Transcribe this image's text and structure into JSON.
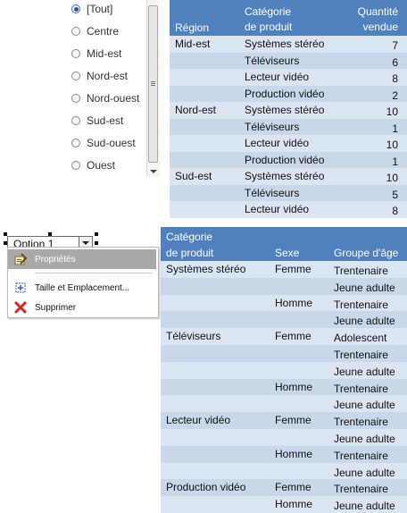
{
  "filter": {
    "options": [
      {
        "label": "[Tout]",
        "checked": true
      },
      {
        "label": "Centre",
        "checked": false
      },
      {
        "label": "Mid-est",
        "checked": false
      },
      {
        "label": "Nord-est",
        "checked": false
      },
      {
        "label": "Nord-ouest",
        "checked": false
      },
      {
        "label": "Sud-est",
        "checked": false
      },
      {
        "label": "Sud-ouest",
        "checked": false
      },
      {
        "label": "Ouest",
        "checked": false
      }
    ]
  },
  "colors": {
    "header": "#4e81bd",
    "band_dark": "#c8d7e9",
    "band_light": "#dbe5f1"
  },
  "table1": {
    "headers": {
      "region": "Région",
      "category": [
        "Catégorie",
        "de produit"
      ],
      "quantity": [
        "Quantité",
        "vendue"
      ]
    },
    "rows": [
      {
        "region": "Mid-est",
        "category": "Systèmes stéréo",
        "quantity": "7"
      },
      {
        "region": "",
        "category": "Téléviseurs",
        "quantity": "6"
      },
      {
        "region": "",
        "category": "Lecteur vidéo",
        "quantity": "8"
      },
      {
        "region": "",
        "category": "Production vidéo",
        "quantity": "2"
      },
      {
        "region": "Nord-est",
        "category": "Systèmes stéréo",
        "quantity": "10"
      },
      {
        "region": "",
        "category": "Téléviseurs",
        "quantity": "1"
      },
      {
        "region": "",
        "category": "Lecteur vidéo",
        "quantity": "10"
      },
      {
        "region": "",
        "category": "Production vidéo",
        "quantity": "1"
      },
      {
        "region": "Sud-est",
        "category": "Systèmes stéréo",
        "quantity": "10"
      },
      {
        "region": "",
        "category": "Téléviseurs",
        "quantity": "5"
      },
      {
        "region": "",
        "category": "Lecteur vidéo",
        "quantity": "8"
      }
    ]
  },
  "table2": {
    "headers": {
      "category": [
        "Catégorie",
        "de produit"
      ],
      "sex": "Sexe",
      "age": "Groupe d'âge"
    },
    "rows": [
      {
        "category": "Systèmes stéréo",
        "sex": "Femme",
        "age": "Trentenaire"
      },
      {
        "category": "",
        "sex": "",
        "age": "Jeune adulte"
      },
      {
        "category": "",
        "sex": "Homme",
        "age": "Trentenaire"
      },
      {
        "category": "",
        "sex": "",
        "age": "Jeune adulte"
      },
      {
        "category": "Téléviseurs",
        "sex": "Femme",
        "age": "Adolescent"
      },
      {
        "category": "",
        "sex": "",
        "age": "Trentenaire"
      },
      {
        "category": "",
        "sex": "",
        "age": "Jeune adulte"
      },
      {
        "category": "",
        "sex": "Homme",
        "age": "Trentenaire"
      },
      {
        "category": "",
        "sex": "",
        "age": "Jeune adulte"
      },
      {
        "category": "Lecteur vidéo",
        "sex": "Femme",
        "age": "Trentenaire"
      },
      {
        "category": "",
        "sex": "",
        "age": "Jeune adulte"
      },
      {
        "category": "",
        "sex": "Homme",
        "age": "Trentenaire"
      },
      {
        "category": "",
        "sex": "",
        "age": "Jeune adulte"
      },
      {
        "category": "Production vidéo",
        "sex": "Femme",
        "age": "Trentenaire"
      },
      {
        "category": "",
        "sex": "Homme",
        "age": "Jeune adulte"
      }
    ]
  },
  "dropdown": {
    "value": "Option 1"
  },
  "context_menu": {
    "items": [
      {
        "label": "Propriétés",
        "icon": "properties-icon",
        "highlighted": true
      },
      {
        "label": "Taille et Emplacement...",
        "icon": "size-position-icon",
        "highlighted": false
      },
      {
        "label": "Supprimer",
        "icon": "delete-icon",
        "highlighted": false
      }
    ]
  }
}
